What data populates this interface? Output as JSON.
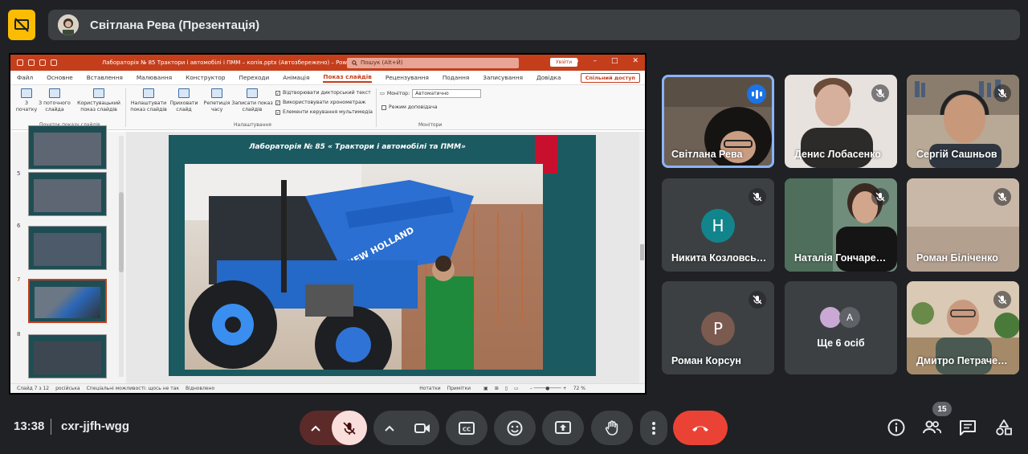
{
  "top_bar": {
    "presenter_title": "Світлана Рева (Презентація)"
  },
  "powerpoint": {
    "doc_title": "Лабораторія № 85 Трактори і автомобілі і ПММ – копія.pptx (Автозбережено) – PowerPoint",
    "search_placeholder": "Пошук (Alt+Й)",
    "signin_label": "Увійти",
    "share_label": "Спільний доступ",
    "menus": [
      "Файл",
      "Основне",
      "Вставлення",
      "Малювання",
      "Конструктор",
      "Переходи",
      "Анімація",
      "Показ слайдів",
      "Рецензування",
      "Подання",
      "Записування",
      "Довідка"
    ],
    "active_menu": "Показ слайдів",
    "ribbon": {
      "from_start": "З початку",
      "from_current": "З поточного слайда",
      "custom_show": "Користувацький показ слайдів",
      "group_start": "Початок показу слайдів",
      "setup_show": "Налаштувати показ слайдів",
      "hide_slide": "Приховати слайд",
      "rehearse": "Репетиція часу",
      "record": "Записати показ слайдів",
      "chk_narrations": "Відтворювати дикторський текст",
      "chk_timings": "Використовувати хронометраж",
      "chk_media": "Елементи керування мультимедіа",
      "group_setup": "Налаштування",
      "monitor_label": "Монітор:",
      "monitor_value": "Автоматично",
      "presenter_view": "Режим доповідача",
      "group_monitors": "Монітори"
    },
    "thumbnails": [
      {
        "num": "",
        "selected": false
      },
      {
        "num": "5",
        "selected": false
      },
      {
        "num": "6",
        "selected": false
      },
      {
        "num": "7",
        "selected": true
      },
      {
        "num": "8",
        "selected": false
      }
    ],
    "slide_title": "Лабораторія № 85 « Трактори і автомобілі та ПММ»",
    "photo_brand": "NEW HOLLAND",
    "status": {
      "slide_info": "Слайд 7 з 12",
      "language": "російська",
      "accessibility": "Спеціальні можливості: щось не так",
      "restored": "Відновлено",
      "notes": "Нотатки",
      "comments": "Примітки",
      "zoom": "72 %"
    }
  },
  "participants": [
    {
      "name": "Світлана Рева",
      "speaking": true,
      "muted": false
    },
    {
      "name": "Денис Лобасенко",
      "speaking": false,
      "muted": true
    },
    {
      "name": "Сергій Сашньов",
      "speaking": false,
      "muted": true
    },
    {
      "name": "Никита Козловський",
      "speaking": false,
      "muted": true,
      "letter": "Н",
      "color": "#12858c"
    },
    {
      "name": "Наталія Гончаренко",
      "speaking": false,
      "muted": true
    },
    {
      "name": "Роман Біліченко",
      "speaking": false,
      "muted": true
    },
    {
      "name": "Роман Корсун",
      "speaking": false,
      "muted": true,
      "letter": "Р",
      "color": "#7b5a4f"
    },
    {
      "name": "Ще 6 осіб",
      "more": true,
      "mini_letter": "A"
    },
    {
      "name": "Дмитро Петраченко",
      "speaking": false,
      "muted": true
    }
  ],
  "bottom_bar": {
    "time": "13:38",
    "meeting_code": "cxr-jjfh-wgg",
    "participant_count": "15"
  },
  "colors": {
    "meet_bg": "#202124",
    "tile_bg": "#3c4043",
    "ppt_red": "#c43e1c",
    "end_call": "#ea4335",
    "mic_off": "#f9dedc",
    "present_yellow": "#fbbc04"
  }
}
